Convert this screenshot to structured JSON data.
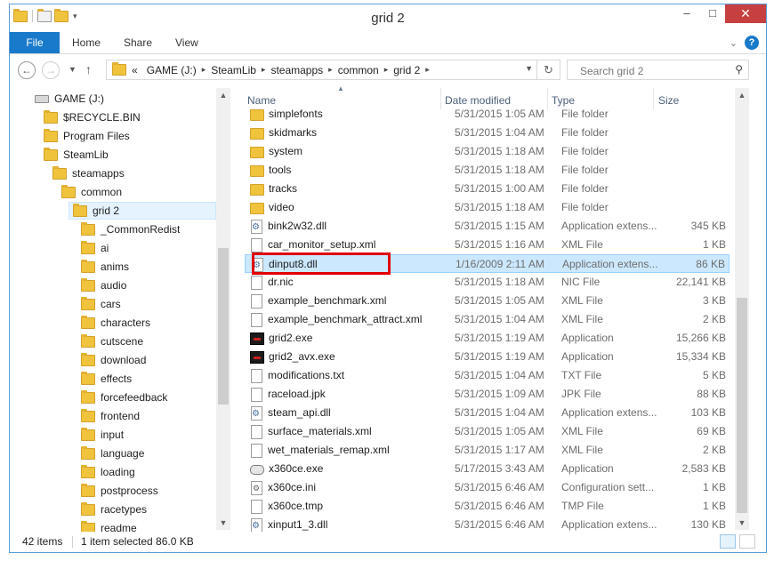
{
  "window": {
    "title": "grid 2",
    "minimize": "–",
    "maximize": "□",
    "close": "✕"
  },
  "ribbon": {
    "tabs": [
      "File",
      "Home",
      "Share",
      "View"
    ],
    "help": "?"
  },
  "address": {
    "prefix": "«",
    "crumbs": [
      "GAME (J:)",
      "SteamLib",
      "steamapps",
      "common",
      "grid 2"
    ],
    "search_placeholder": "Search grid 2"
  },
  "nav": {
    "items": [
      {
        "label": "GAME (J:)",
        "icon": "drive-icon",
        "level": 0
      },
      {
        "label": "$RECYCLE.BIN",
        "icon": "folder-icon",
        "level": 1
      },
      {
        "label": "Program Files",
        "icon": "folder-icon",
        "level": 1
      },
      {
        "label": "SteamLib",
        "icon": "folder-icon",
        "level": 1
      },
      {
        "label": "steamapps",
        "icon": "folder-icon",
        "level": 2
      },
      {
        "label": "common",
        "icon": "folder-icon",
        "level": 3
      },
      {
        "label": "grid 2",
        "icon": "folder-icon",
        "level": 4,
        "selected": true
      },
      {
        "label": "_CommonRedist",
        "icon": "folder-icon",
        "level": 5
      },
      {
        "label": "ai",
        "icon": "folder-icon",
        "level": 5
      },
      {
        "label": "anims",
        "icon": "folder-icon",
        "level": 5
      },
      {
        "label": "audio",
        "icon": "folder-icon",
        "level": 5
      },
      {
        "label": "cars",
        "icon": "folder-icon",
        "level": 5
      },
      {
        "label": "characters",
        "icon": "folder-icon",
        "level": 5
      },
      {
        "label": "cutscene",
        "icon": "folder-icon",
        "level": 5
      },
      {
        "label": "download",
        "icon": "folder-icon",
        "level": 5
      },
      {
        "label": "effects",
        "icon": "folder-icon",
        "level": 5
      },
      {
        "label": "forcefeedback",
        "icon": "folder-icon",
        "level": 5
      },
      {
        "label": "frontend",
        "icon": "folder-icon",
        "level": 5
      },
      {
        "label": "input",
        "icon": "folder-icon",
        "level": 5
      },
      {
        "label": "language",
        "icon": "folder-icon",
        "level": 5
      },
      {
        "label": "loading",
        "icon": "folder-icon",
        "level": 5
      },
      {
        "label": "postprocess",
        "icon": "folder-icon",
        "level": 5
      },
      {
        "label": "racetypes",
        "icon": "folder-icon",
        "level": 5
      },
      {
        "label": "readme",
        "icon": "folder-icon",
        "level": 5
      }
    ]
  },
  "columns": [
    "Name",
    "Date modified",
    "Type",
    "Size"
  ],
  "files": [
    {
      "name": "simplefonts",
      "date": "5/31/2015 1:05 AM",
      "type": "File folder",
      "size": "",
      "icon": "folder"
    },
    {
      "name": "skidmarks",
      "date": "5/31/2015 1:04 AM",
      "type": "File folder",
      "size": "",
      "icon": "folder"
    },
    {
      "name": "system",
      "date": "5/31/2015 1:18 AM",
      "type": "File folder",
      "size": "",
      "icon": "folder"
    },
    {
      "name": "tools",
      "date": "5/31/2015 1:18 AM",
      "type": "File folder",
      "size": "",
      "icon": "folder"
    },
    {
      "name": "tracks",
      "date": "5/31/2015 1:00 AM",
      "type": "File folder",
      "size": "",
      "icon": "folder"
    },
    {
      "name": "video",
      "date": "5/31/2015 1:18 AM",
      "type": "File folder",
      "size": "",
      "icon": "folder"
    },
    {
      "name": "bink2w32.dll",
      "date": "5/31/2015 1:15 AM",
      "type": "Application extens...",
      "size": "345 KB",
      "icon": "dll"
    },
    {
      "name": "car_monitor_setup.xml",
      "date": "5/31/2015 1:16 AM",
      "type": "XML File",
      "size": "1 KB",
      "icon": "doc"
    },
    {
      "name": "dinput8.dll",
      "date": "1/16/2009 2:11 AM",
      "type": "Application extens...",
      "size": "86 KB",
      "icon": "dll",
      "selected": true
    },
    {
      "name": "dr.nic",
      "date": "5/31/2015 1:18 AM",
      "type": "NIC File",
      "size": "22,141 KB",
      "icon": "doc"
    },
    {
      "name": "example_benchmark.xml",
      "date": "5/31/2015 1:05 AM",
      "type": "XML File",
      "size": "3 KB",
      "icon": "doc"
    },
    {
      "name": "example_benchmark_attract.xml",
      "date": "5/31/2015 1:04 AM",
      "type": "XML File",
      "size": "2 KB",
      "icon": "doc"
    },
    {
      "name": "grid2.exe",
      "date": "5/31/2015 1:19 AM",
      "type": "Application",
      "size": "15,266 KB",
      "icon": "exe"
    },
    {
      "name": "grid2_avx.exe",
      "date": "5/31/2015 1:19 AM",
      "type": "Application",
      "size": "15,334 KB",
      "icon": "exe"
    },
    {
      "name": "modifications.txt",
      "date": "5/31/2015 1:04 AM",
      "type": "TXT File",
      "size": "5 KB",
      "icon": "doc"
    },
    {
      "name": "raceload.jpk",
      "date": "5/31/2015 1:09 AM",
      "type": "JPK File",
      "size": "88 KB",
      "icon": "doc"
    },
    {
      "name": "steam_api.dll",
      "date": "5/31/2015 1:04 AM",
      "type": "Application extens...",
      "size": "103 KB",
      "icon": "dll"
    },
    {
      "name": "surface_materials.xml",
      "date": "5/31/2015 1:05 AM",
      "type": "XML File",
      "size": "69 KB",
      "icon": "doc"
    },
    {
      "name": "wet_materials_remap.xml",
      "date": "5/31/2015 1:17 AM",
      "type": "XML File",
      "size": "2 KB",
      "icon": "doc"
    },
    {
      "name": "x360ce.exe",
      "date": "5/17/2015 3:43 AM",
      "type": "Application",
      "size": "2,583 KB",
      "icon": "pad"
    },
    {
      "name": "x360ce.ini",
      "date": "5/31/2015 6:46 AM",
      "type": "Configuration sett...",
      "size": "1 KB",
      "icon": "ini"
    },
    {
      "name": "x360ce.tmp",
      "date": "5/31/2015 6:46 AM",
      "type": "TMP File",
      "size": "1 KB",
      "icon": "doc"
    },
    {
      "name": "xinput1_3.dll",
      "date": "5/31/2015 6:46 AM",
      "type": "Application extens...",
      "size": "130 KB",
      "icon": "dll"
    }
  ],
  "status": {
    "count": "42 items",
    "selection": "1 item selected  86.0 KB"
  },
  "colors": {
    "accent": "#1979ca",
    "close": "#c74040",
    "selection": "#cce8ff",
    "highlight_box": "#e00000"
  }
}
